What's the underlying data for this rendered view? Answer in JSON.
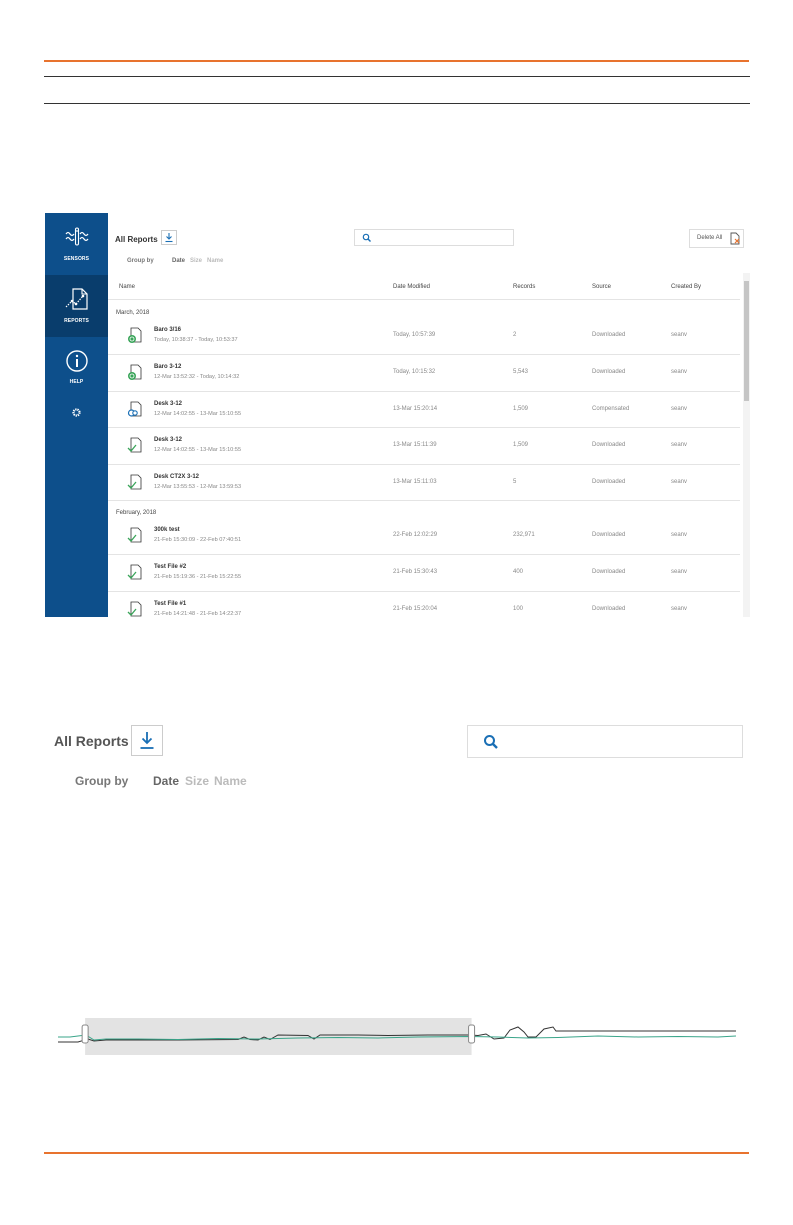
{
  "app": {
    "sidebar": {
      "items": [
        {
          "label": "SENSORS",
          "icon": "sensors-icon"
        },
        {
          "label": "REPORTS",
          "icon": "reports-icon",
          "active": true
        },
        {
          "label": "HELP",
          "icon": "help-icon"
        },
        {
          "label": "",
          "icon": "settings-gear-icon"
        }
      ]
    },
    "toolbar": {
      "title": "All Reports",
      "download_icon": "download-icon",
      "search_icon": "search-icon",
      "search_value": "",
      "delete_all_label": "Delete All",
      "delete_all_icon": "delete-file-icon"
    },
    "group_by": {
      "label": "Group by",
      "options": [
        "Date",
        "Size",
        "Name"
      ],
      "selected": "Date"
    },
    "columns": [
      "Name",
      "Date Modified",
      "Records",
      "Source",
      "Created By"
    ],
    "groups": [
      {
        "label": "March, 2018",
        "rows": [
          {
            "name": "Baro 3/16",
            "range": "Today, 10:38:37 - Today, 10:53:37",
            "date_modified": "Today, 10:57:39",
            "records": "2",
            "source": "Downloaded",
            "created_by": "seanv",
            "icon": "baro-file-icon"
          },
          {
            "name": "Baro 3-12",
            "range": "12-Mar 13:52:32 - Today, 10:14:32",
            "date_modified": "Today, 10:15:32",
            "records": "5,543",
            "source": "Downloaded",
            "created_by": "seanv",
            "icon": "baro-file-icon"
          },
          {
            "name": "Desk 3-12",
            "range": "12-Mar 14:02:55 - 13-Mar 15:10:55",
            "date_modified": "13-Mar 15:20:14",
            "records": "1,509",
            "source": "Compensated",
            "created_by": "seanv",
            "icon": "compensated-file-icon"
          },
          {
            "name": "Desk 3-12",
            "range": "12-Mar 14:02:55 - 13-Mar 15:10:55",
            "date_modified": "13-Mar 15:11:39",
            "records": "1,509",
            "source": "Downloaded",
            "created_by": "seanv",
            "icon": "downloaded-file-icon"
          },
          {
            "name": "Desk CT2X 3-12",
            "range": "12-Mar 13:55:53 - 12-Mar 13:59:53",
            "date_modified": "13-Mar 15:11:03",
            "records": "5",
            "source": "Downloaded",
            "created_by": "seanv",
            "icon": "downloaded-file-icon"
          }
        ]
      },
      {
        "label": "February, 2018",
        "rows": [
          {
            "name": "300k test",
            "range": "21-Feb 15:30:09 - 22-Feb 07:40:51",
            "date_modified": "22-Feb 12:02:29",
            "records": "232,971",
            "source": "Downloaded",
            "created_by": "seanv",
            "icon": "downloaded-file-icon"
          },
          {
            "name": "Test File #2",
            "range": "21-Feb 15:19:36 - 21-Feb 15:22:55",
            "date_modified": "21-Feb 15:30:43",
            "records": "400",
            "source": "Downloaded",
            "created_by": "seanv",
            "icon": "downloaded-file-icon"
          },
          {
            "name": "Test File #1",
            "range": "21-Feb 14:21:48 - 21-Feb 14:22:37",
            "date_modified": "21-Feb 15:20:04",
            "records": "100",
            "source": "Downloaded",
            "created_by": "seanv",
            "icon": "downloaded-file-icon"
          }
        ]
      }
    ]
  },
  "zoom": {
    "title": "All Reports",
    "download_icon": "download-icon",
    "search_icon": "search-icon",
    "search_value": "",
    "group_by_label": "Group by",
    "options": [
      "Date",
      "Size",
      "Name"
    ],
    "selected": "Date"
  },
  "range_slider": {
    "selection_start_fraction": 0.04,
    "selection_end_fraction": 0.61,
    "series_colors": [
      "#333333",
      "#3aa58a"
    ]
  },
  "colors": {
    "accent_orange": "#e8732e",
    "sidebar_blue": "#0d4f8b",
    "sidebar_active": "#093d6c",
    "link_blue": "#1a6fb5",
    "check_green": "#3aa55a",
    "muted_text": "#888888"
  }
}
